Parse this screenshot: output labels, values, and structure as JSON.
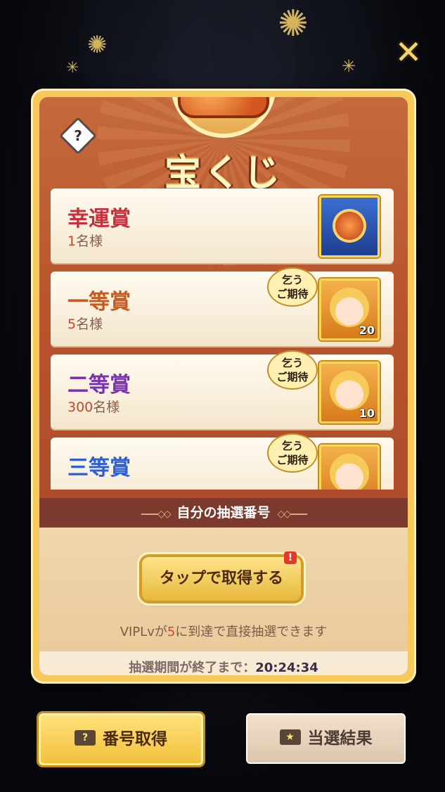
{
  "close_label": "✕",
  "help_label": "?",
  "title": "宝くじ",
  "prizes": [
    {
      "name": "幸運賞",
      "count": "1",
      "count_suffix": "名様",
      "color": "#c7303c",
      "bubble": "",
      "qty": ""
    },
    {
      "name": "一等賞",
      "count": "5",
      "count_suffix": "名様",
      "color": "#c75a20",
      "bubble": "乞う\nご期待",
      "qty": "20"
    },
    {
      "name": "二等賞",
      "count": "300",
      "count_suffix": "名様",
      "color": "#7a33b0",
      "bubble": "乞う\nご期待",
      "qty": "10"
    },
    {
      "name": "三等賞",
      "count": "",
      "count_suffix": "",
      "color": "#2a5fd6",
      "bubble": "乞う\nご期待",
      "qty": ""
    }
  ],
  "band_label": "自分の抽選番号",
  "tap_button": "タップで取得する",
  "badge": "!",
  "vip_prefix": "VIPLvが",
  "vip_level": "5",
  "vip_suffix": "に到達で直接抽選できます",
  "period_label": "抽選期間が終了まで：",
  "period_time": "20:24:34",
  "buttons": {
    "get": "番号取得",
    "result": "当選結果"
  },
  "colors": {
    "panel": "#b7532d",
    "gold": "#f6c95a"
  }
}
